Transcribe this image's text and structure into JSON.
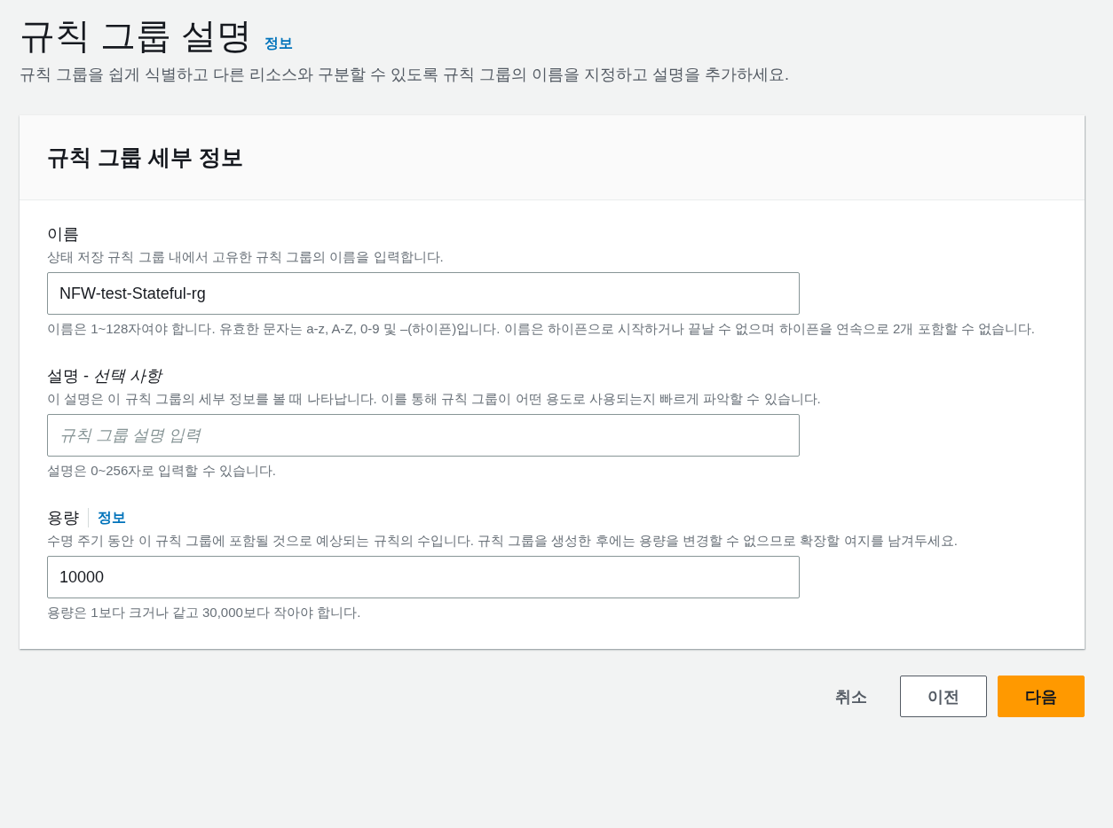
{
  "header": {
    "title": "규칙 그룹 설명",
    "info_link": "정보",
    "description": "규칙 그룹을 쉽게 식별하고 다른 리소스와 구분할 수 있도록 규칙 그룹의 이름을 지정하고 설명을 추가하세요."
  },
  "card": {
    "title": "규칙 그룹 세부 정보",
    "fields": [
      {
        "label": "이름",
        "description": "상태 저장 규칙 그룹 내에서 고유한 규칙 그룹의 이름을 입력합니다.",
        "value": "NFW-test-Stateful-rg",
        "constraint": "이름은 1~128자여야 합니다. 유효한 문자는 a-z, A-Z, 0-9 및 –(하이픈)입니다. 이름은 하이픈으로 시작하거나 끝날 수 없으며 하이픈을 연속으로 2개 포함할 수 없습니다."
      },
      {
        "label": "설명 - *선택 사항*",
        "description": "이 설명은 이 규칙 그룹의 세부 정보를 볼 때 나타납니다. 이를 통해 규칙 그룹이 어떤 용도로 사용되는지 빠르게 파악할 수 있습니다.",
        "placeholder": "규칙 그룹 설명 입력",
        "constraint": "설명은 0~256자로 입력할 수 있습니다."
      },
      {
        "label": "용량",
        "info_link": "정보",
        "description": "수명 주기 동안 이 규칙 그룹에 포함될 것으로 예상되는 규칙의 수입니다. 규칙 그룹을 생성한 후에는 용량을 변경할 수 없으므로 확장할 여지를 남겨두세요.",
        "value": "10000",
        "constraint": "용량은 1보다 크거나 같고 30,000보다 작아야 합니다."
      }
    ]
  },
  "buttons": [
    {
      "label": "취소",
      "kind": "link"
    },
    {
      "label": "이전",
      "kind": "normal"
    },
    {
      "label": "다음",
      "kind": "primary"
    }
  ]
}
